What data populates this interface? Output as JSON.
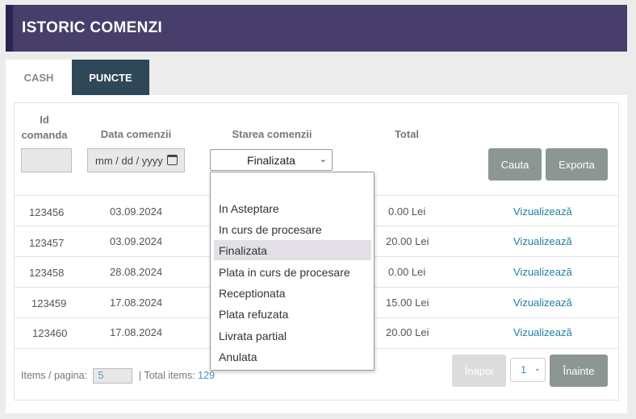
{
  "header": {
    "title": "ISTORIC COMENZI"
  },
  "tabs": [
    {
      "label": "CASH"
    },
    {
      "label": "PUNCTE"
    }
  ],
  "columns": {
    "id": "Id comanda",
    "date": "Data comenzii",
    "status": "Starea comenzii",
    "total": "Total"
  },
  "filters": {
    "date_placeholder": "mm / dd / yyyy",
    "status_value": "Finalizata"
  },
  "buttons": {
    "search": "Cauta",
    "export": "Exporta",
    "prev": "Înapoi",
    "next": "Înainte"
  },
  "rows": [
    {
      "id": "123456",
      "date": "03.09.2024",
      "total": "0.00 Lei",
      "action": "Vizualizează"
    },
    {
      "id": "123457",
      "date": "03.09.2024",
      "total": "20.00 Lei",
      "action": "Vizualizează"
    },
    {
      "id": "123458",
      "date": "28.08.2024",
      "total": "0.00 Lei",
      "action": "Vizualizează"
    },
    {
      "id": "123459",
      "date": "17.08.2024",
      "total": "15.00 Lei",
      "action": "Vizualizează"
    },
    {
      "id": "123460",
      "date": "17.08.2024",
      "total": "20.00 Lei",
      "action": "Vizualizează"
    }
  ],
  "pagination": {
    "items_label": "Items / pagina:",
    "items_per_page": "5",
    "total_label": "| Total items:",
    "total_items": "129",
    "current_page": "1"
  },
  "dropdown_options": [
    "",
    "In Asteptare",
    "In curs de procesare",
    "Finalizata",
    "Plata in curs de procesare",
    "Receptionata",
    "Plata refuzata",
    "Livrata partial",
    "Anulata"
  ],
  "colors": {
    "header": "#473e6b",
    "active_tab": "#2f4858",
    "button": "#8c9694",
    "link": "#1f7ea1"
  }
}
